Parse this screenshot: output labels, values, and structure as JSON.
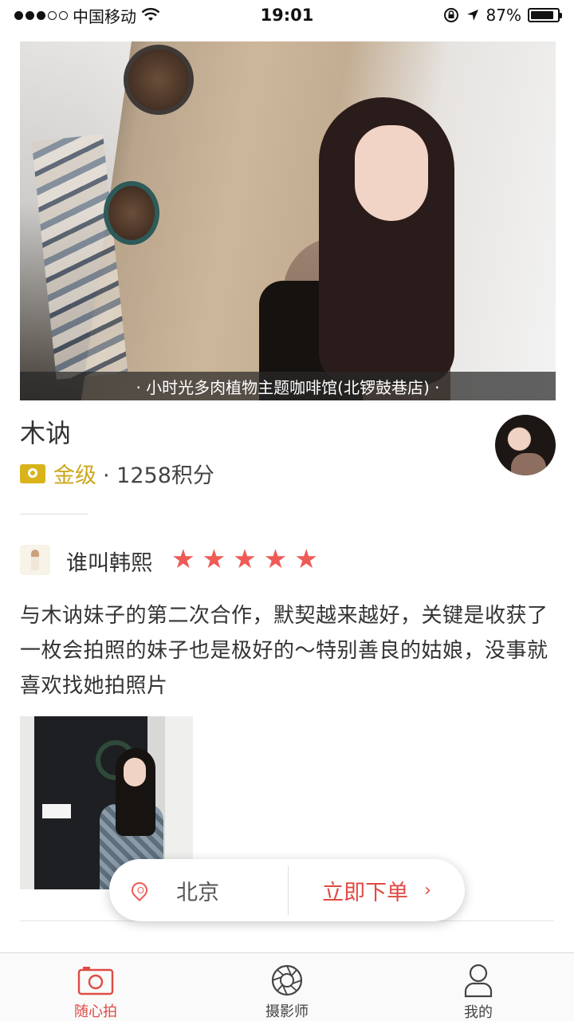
{
  "status_bar": {
    "carrier": "中国移动",
    "time": "19:01",
    "battery": "87%",
    "battery_level": 0.87
  },
  "hero": {
    "caption": "· 小时光多肉植物主题咖啡馆(北锣鼓巷店) ·"
  },
  "profile": {
    "name": "木讷",
    "level": "金级",
    "points": "· 1258积分"
  },
  "review": {
    "reviewer": "谁叫韩熙",
    "rating": 5,
    "rating_max": 5,
    "text": "与木讷妹子的第二次合作，默契越来越好，关键是收获了一枚会拍照的妹子也是极好的～特别善良的姑娘，没事就喜欢找她拍照片"
  },
  "order": {
    "city": "北京",
    "button": "立即下单",
    "chevron": "›"
  },
  "tabs": [
    {
      "label": "随心拍",
      "icon": "camera-icon",
      "active": true
    },
    {
      "label": "摄影师",
      "icon": "aperture-icon",
      "active": false
    },
    {
      "label": "我的",
      "icon": "user-icon",
      "active": false
    }
  ],
  "colors": {
    "accent": "#e04a44",
    "star": "#ef5a55",
    "gold": "#cda71a"
  }
}
